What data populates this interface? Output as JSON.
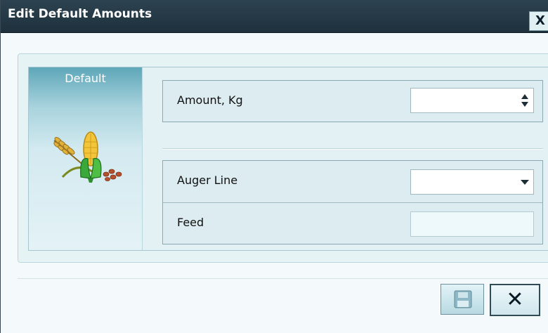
{
  "window": {
    "title": "Edit Default Amounts",
    "close_glyph": "X"
  },
  "panel": {
    "side_label": "Default",
    "side_icon": "crop-icon"
  },
  "fields": {
    "amount": {
      "label": "Amount, Kg",
      "value": ""
    },
    "auger_line": {
      "label": "Auger Line",
      "value": ""
    },
    "feed": {
      "label": "Feed",
      "value": ""
    }
  },
  "footer": {
    "close_glyph": "✕"
  }
}
